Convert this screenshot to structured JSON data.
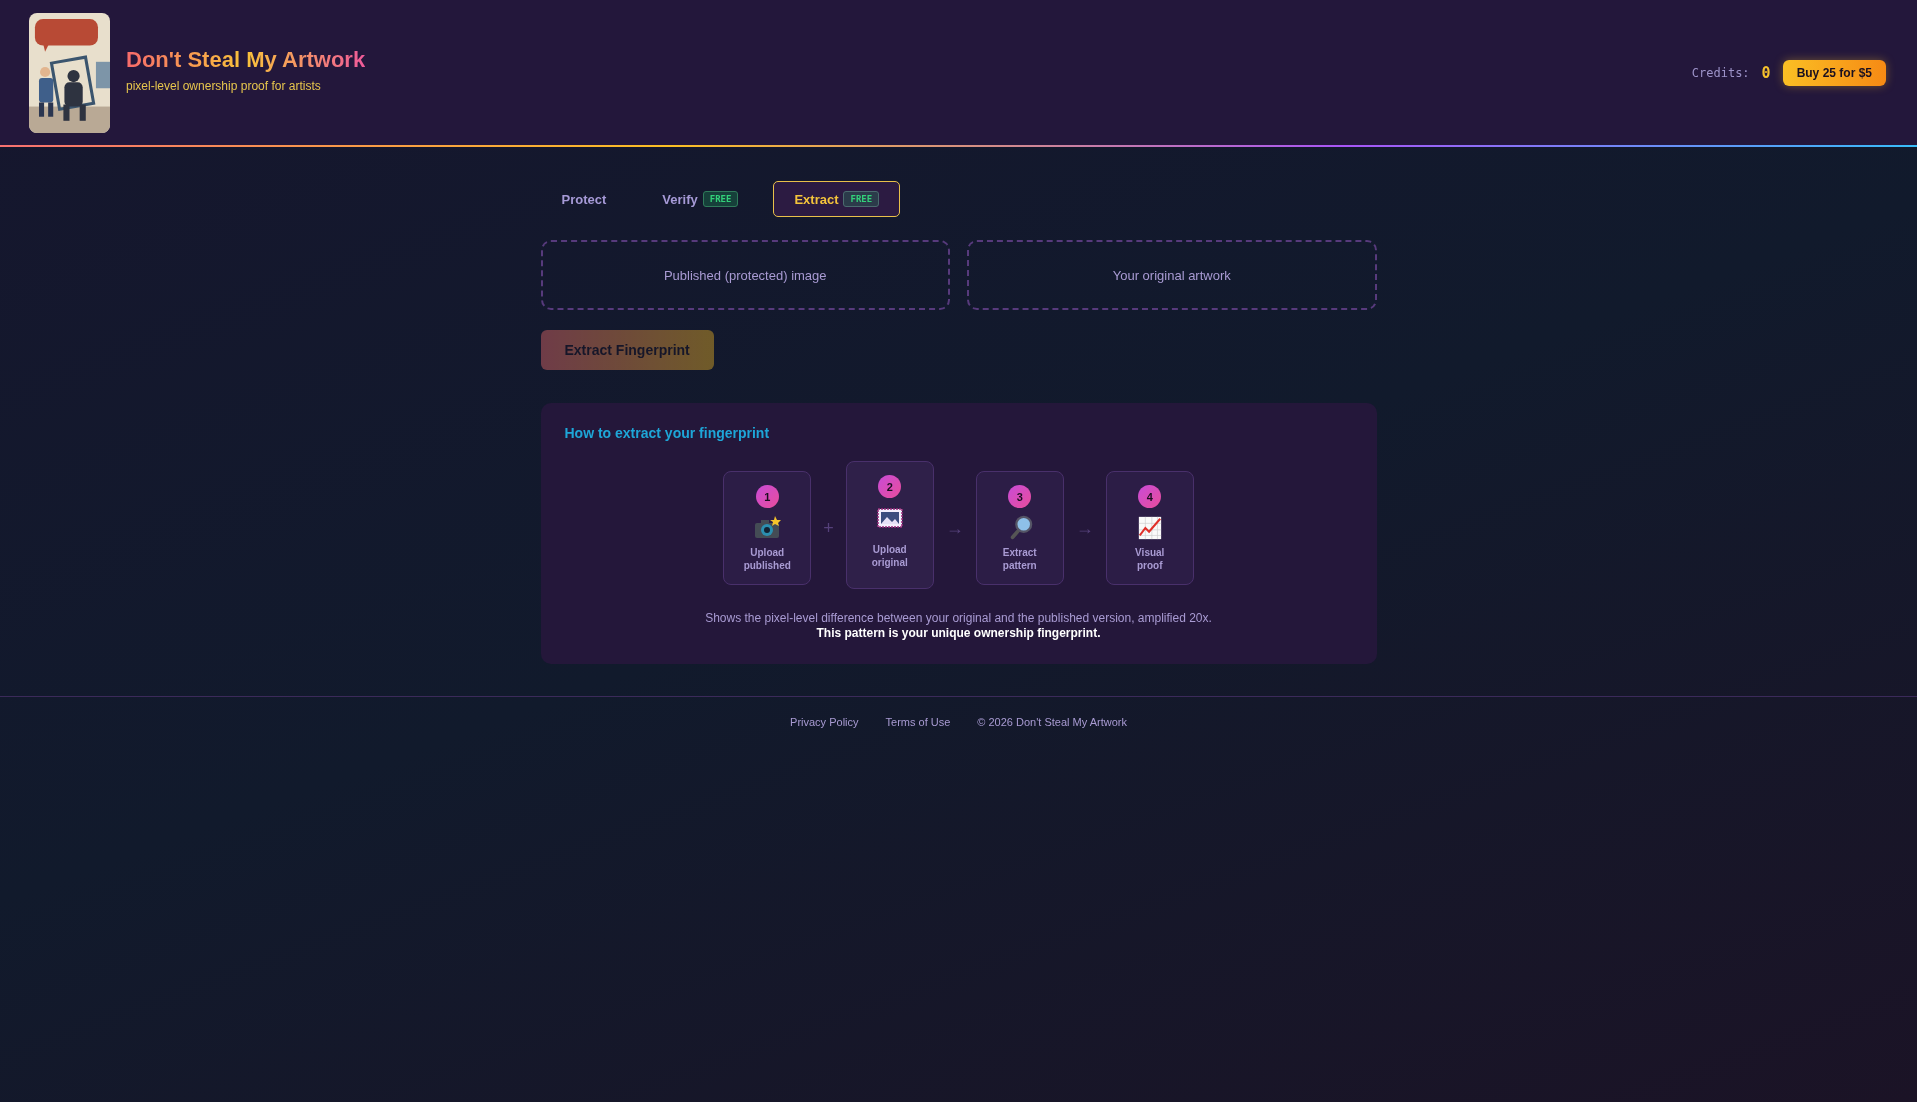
{
  "header": {
    "title": "Don't Steal My Artwork",
    "tagline": "pixel-level ownership proof for artists",
    "credits_label": "Credits:",
    "credits_value": "0",
    "buy_button": "Buy 25 for $5"
  },
  "tabs": [
    {
      "label": "Protect",
      "selected": false
    },
    {
      "label": "Verify",
      "badge": "FREE",
      "selected": false
    },
    {
      "label": "Extract",
      "badge": "FREE",
      "selected": true
    }
  ],
  "dropzones": [
    "Published (protected) image",
    "Your original artwork"
  ],
  "extract_button": {
    "label": "Extract Fingerprint",
    "disabled": true
  },
  "how_to": {
    "title": "How to extract your fingerprint",
    "steps": [
      {
        "number": "1",
        "kind": "camera",
        "label": "Upload published",
        "raised": false
      },
      {
        "joiner": "+",
        "number": "2",
        "label": "Upload original",
        "raised": true
      },
      {
        "joiner": "→",
        "number": "3",
        "kind": "magnifier",
        "label": "Extract pattern",
        "raised": false
      },
      {
        "joiner": "→",
        "number": "4",
        "kind": "chart",
        "label": "Visual proof",
        "raised": false
      }
    ],
    "note": "Shows the pixel-level difference between your original and the published version, amplified 20x.",
    "note_strong": "This pattern is your unique ownership fingerprint."
  },
  "footer": [
    "Privacy Policy",
    "Terms of Use",
    "© 2026 Don't Steal My Artwork"
  ]
}
